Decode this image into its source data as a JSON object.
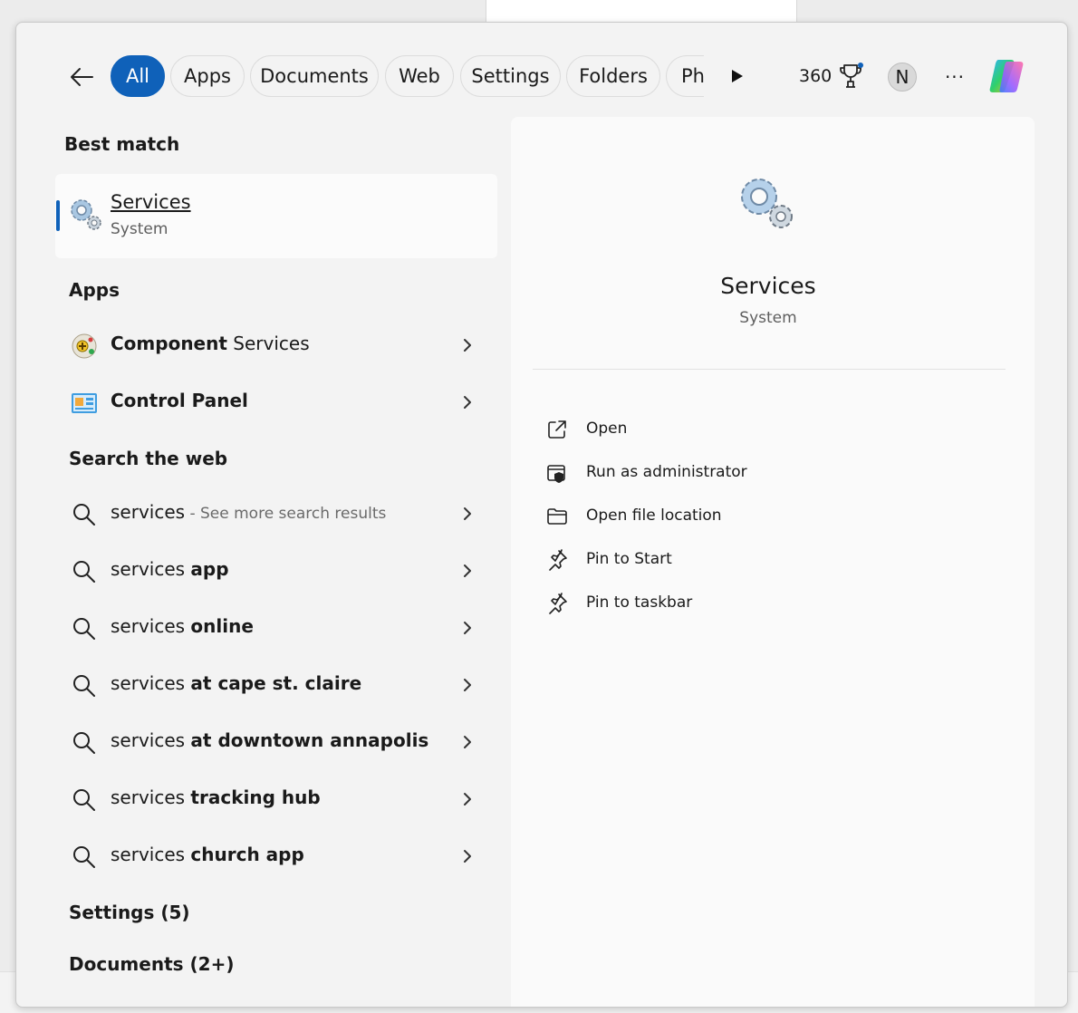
{
  "tabs": [
    {
      "label": "All",
      "active": true
    },
    {
      "label": "Apps"
    },
    {
      "label": "Documents"
    },
    {
      "label": "Web"
    },
    {
      "label": "Settings"
    },
    {
      "label": "Folders"
    },
    {
      "label": "Ph"
    }
  ],
  "toolbar": {
    "points": "360",
    "avatar_initial": "N",
    "more_label": "···"
  },
  "best_match": {
    "heading": "Best match",
    "title": "Services",
    "subtitle": "System",
    "icon": "gears-icon"
  },
  "apps": {
    "heading": "Apps",
    "items": [
      {
        "bold": "Component",
        "rest": " Services",
        "icon": "component-services-icon"
      },
      {
        "bold": "Control Panel",
        "rest": "",
        "icon": "control-panel-icon"
      }
    ]
  },
  "web": {
    "heading": "Search the web",
    "items": [
      {
        "query": "services",
        "bold": "",
        "extra": " - See more search results"
      },
      {
        "query": "services ",
        "bold": "app",
        "extra": ""
      },
      {
        "query": "services ",
        "bold": "online",
        "extra": ""
      },
      {
        "query": "services ",
        "bold": "at cape st. claire",
        "extra": ""
      },
      {
        "query": "services ",
        "bold": "at downtown annapolis",
        "extra": ""
      },
      {
        "query": "services ",
        "bold": "tracking hub",
        "extra": ""
      },
      {
        "query": "services ",
        "bold": "church app",
        "extra": ""
      }
    ]
  },
  "more_sections": {
    "settings": "Settings (5)",
    "documents": "Documents (2+)"
  },
  "detail": {
    "title": "Services",
    "subtitle": "System",
    "actions": [
      {
        "label": "Open",
        "icon": "open-external-icon"
      },
      {
        "label": "Run as administrator",
        "icon": "shield-icon"
      },
      {
        "label": "Open file location",
        "icon": "folder-icon"
      },
      {
        "label": "Pin to Start",
        "icon": "pin-icon"
      },
      {
        "label": "Pin to taskbar",
        "icon": "pin-icon"
      }
    ]
  },
  "colors": {
    "accent": "#0f61b9",
    "panel_bg": "#f3f3f3",
    "card_bg": "#fafafa"
  }
}
